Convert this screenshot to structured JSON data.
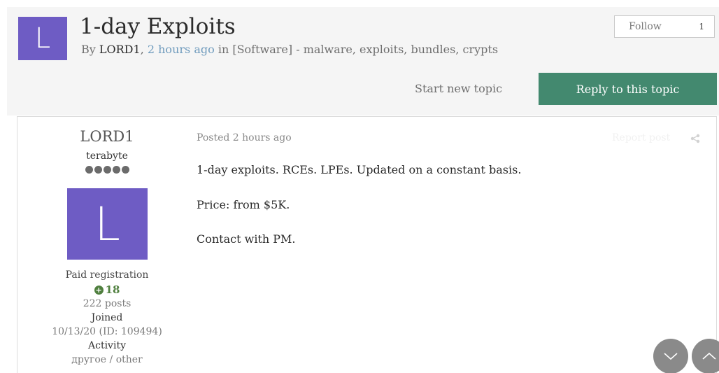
{
  "topic": {
    "avatar_letter": "L",
    "title": "1-day Exploits",
    "by_prefix": "By ",
    "author": "LORD1",
    "comma": ", ",
    "time": "2 hours ago",
    "in_text": " in [Software] - malware, exploits, bundles, crypts"
  },
  "follow": {
    "label": "Follow",
    "count": "1"
  },
  "actions": {
    "start_new_topic": "Start new topic",
    "reply": "Reply to this topic"
  },
  "author_panel": {
    "name": "LORD1",
    "rank": "terabyte",
    "rank_pips": 5,
    "avatar_letter": "L",
    "group": "Paid registration",
    "reputation": "18",
    "posts": "222 posts",
    "joined_label": "Joined",
    "joined_value": "10/13/20 (ID: 109494)",
    "activity_label": "Activity",
    "activity_value": "другое / other"
  },
  "post": {
    "date": "Posted 2 hours ago",
    "report": "Report post",
    "lines": [
      "1-day exploits. RCEs. LPEs. Updated on a constant basis.",
      "Price: from $5K.",
      "Contact with PM."
    ]
  },
  "icons": {
    "share": "share-icon",
    "scroll_down": "chevron-down-icon",
    "scroll_up": "chevron-up-icon"
  },
  "colors": {
    "avatar": "#6e5cc4",
    "reply_button": "#43896f",
    "link": "#6f9bbd",
    "reputation": "#4f7f3e"
  }
}
